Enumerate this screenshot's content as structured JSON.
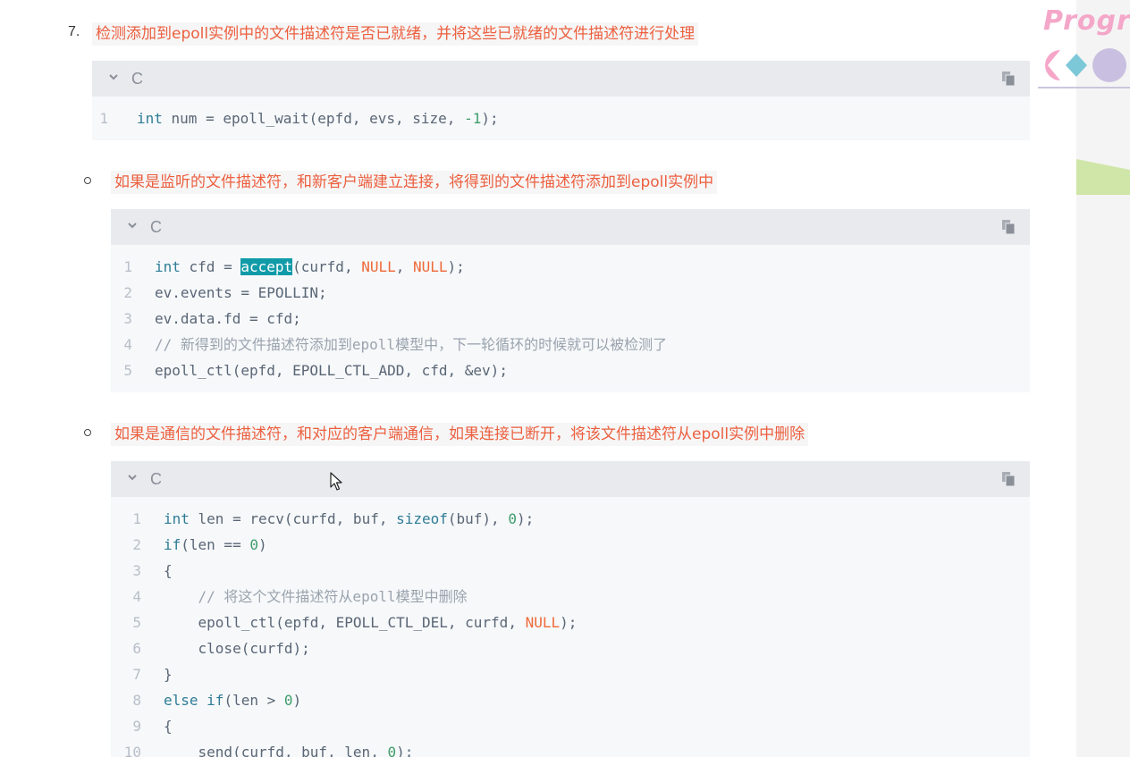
{
  "brand": {
    "text": "Program"
  },
  "step7": {
    "number": "7.",
    "heading": "检测添加到epoll实例中的文件描述符是否已就绪，并将这些已就绪的文件描述符进行处理",
    "code": {
      "lang": "C",
      "lines": [
        {
          "n": "1",
          "tokens": [
            [
              "kw",
              "int"
            ],
            [
              "p",
              " num = epoll_wait(epfd, evs, size, "
            ],
            [
              "num",
              "-1"
            ],
            [
              "p",
              ");"
            ]
          ]
        }
      ]
    }
  },
  "bullet1": {
    "text": "如果是监听的文件描述符，和新客户端建立连接，将得到的文件描述符添加到epoll实例中",
    "code": {
      "lang": "C",
      "lines": [
        {
          "n": "1",
          "tokens": [
            [
              "kw",
              "int"
            ],
            [
              "p",
              " cfd = "
            ],
            [
              "sel",
              "accept"
            ],
            [
              "p",
              "(curfd, "
            ],
            [
              "nul",
              "NULL"
            ],
            [
              "p",
              ", "
            ],
            [
              "nul",
              "NULL"
            ],
            [
              "p",
              ");"
            ]
          ]
        },
        {
          "n": "2",
          "tokens": [
            [
              "p",
              "ev.events = EPOLLIN;"
            ]
          ]
        },
        {
          "n": "3",
          "tokens": [
            [
              "p",
              "ev.data.fd = cfd;"
            ]
          ]
        },
        {
          "n": "4",
          "tokens": [
            [
              "cmt",
              "// 新得到的文件描述符添加到epoll模型中，下一轮循环的时候就可以被检测了"
            ]
          ]
        },
        {
          "n": "5",
          "tokens": [
            [
              "p",
              "epoll_ctl(epfd, EPOLL_CTL_ADD, cfd, &ev);"
            ]
          ]
        }
      ]
    }
  },
  "bullet2": {
    "text": "如果是通信的文件描述符，和对应的客户端通信，如果连接已断开，将该文件描述符从epoll实例中删除",
    "code": {
      "lang": "C",
      "lines": [
        {
          "n": "1",
          "tokens": [
            [
              "kw",
              "int"
            ],
            [
              "p",
              " len = recv(curfd, buf, "
            ],
            [
              "kw",
              "sizeof"
            ],
            [
              "p",
              "(buf), "
            ],
            [
              "num",
              "0"
            ],
            [
              "p",
              ");"
            ]
          ]
        },
        {
          "n": "2",
          "tokens": [
            [
              "kw",
              "if"
            ],
            [
              "p",
              "(len == "
            ],
            [
              "num",
              "0"
            ],
            [
              "p",
              ")"
            ]
          ]
        },
        {
          "n": "3",
          "tokens": [
            [
              "p",
              "{"
            ]
          ]
        },
        {
          "n": "4",
          "tokens": [
            [
              "p",
              "    "
            ],
            [
              "cmt",
              "// 将这个文件描述符从epoll模型中删除"
            ]
          ]
        },
        {
          "n": "5",
          "tokens": [
            [
              "p",
              "    epoll_ctl(epfd, EPOLL_CTL_DEL, curfd, "
            ],
            [
              "nul",
              "NULL"
            ],
            [
              "p",
              ");"
            ]
          ]
        },
        {
          "n": "6",
          "tokens": [
            [
              "p",
              "    close(curfd);"
            ]
          ]
        },
        {
          "n": "7",
          "tokens": [
            [
              "p",
              "}"
            ]
          ]
        },
        {
          "n": "8",
          "tokens": [
            [
              "kw",
              "else"
            ],
            [
              "p",
              " "
            ],
            [
              "kw",
              "if"
            ],
            [
              "p",
              "(len > "
            ],
            [
              "num",
              "0"
            ],
            [
              "p",
              ")"
            ]
          ]
        },
        {
          "n": "9",
          "tokens": [
            [
              "p",
              "{"
            ]
          ]
        },
        {
          "n": "10",
          "tokens": [
            [
              "p",
              "    send(curfd, buf, len, "
            ],
            [
              "num",
              "0"
            ],
            [
              "p",
              ");"
            ]
          ]
        }
      ]
    }
  },
  "icons": {
    "collapse": "chevron-down-icon",
    "copy": "copy-icon",
    "cursor": "mouse-cursor-icon"
  },
  "colors": {
    "heading_text": "#ec5f3f",
    "keyword": "#2f7c96",
    "number": "#3f9d6b",
    "null": "#ef6a38",
    "selection": "#119ba8"
  }
}
